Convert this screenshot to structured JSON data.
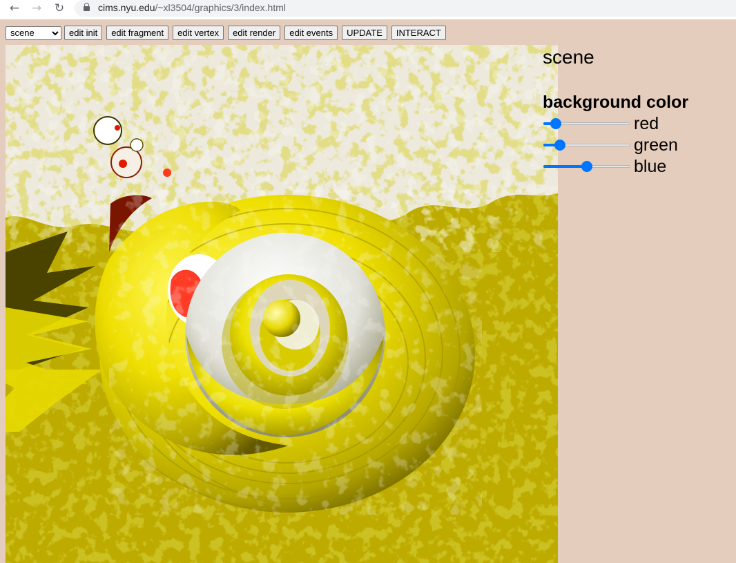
{
  "browser": {
    "url_host": "cims.nyu.edu",
    "url_path": "/~xl3504/graphics/3/index.html"
  },
  "toolbar": {
    "scene_select": {
      "value": "scene",
      "options": [
        "scene"
      ]
    },
    "buttons": [
      "edit init",
      "edit fragment",
      "edit vertex",
      "edit render",
      "edit events",
      "UPDATE",
      "INTERACT"
    ]
  },
  "panel": {
    "title": "scene",
    "section_title": "background color",
    "sliders": [
      {
        "label": "red",
        "value": 0.1
      },
      {
        "label": "green",
        "value": 0.15
      },
      {
        "label": "blue",
        "value": 0.5
      }
    ]
  },
  "colors": {
    "page_bg": "#e5cdbd",
    "canvas_ground": "#bdab00",
    "canvas_sky": "#ede9dc",
    "shell_yellow": "#f0e000",
    "slider_accent": "#0075ff"
  }
}
